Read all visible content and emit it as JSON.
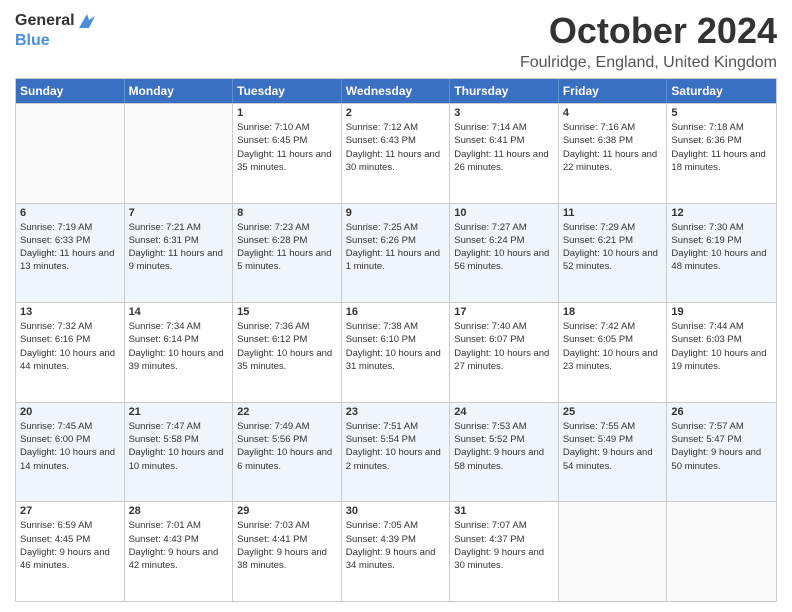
{
  "logo": {
    "general": "General",
    "blue": "Blue"
  },
  "title": {
    "month_year": "October 2024",
    "location": "Foulridge, England, United Kingdom"
  },
  "days_of_week": [
    "Sunday",
    "Monday",
    "Tuesday",
    "Wednesday",
    "Thursday",
    "Friday",
    "Saturday"
  ],
  "weeks": [
    [
      {
        "day": "",
        "sunrise": "",
        "sunset": "",
        "daylight": "",
        "empty": true
      },
      {
        "day": "",
        "sunrise": "",
        "sunset": "",
        "daylight": "",
        "empty": true
      },
      {
        "day": "1",
        "sunrise": "Sunrise: 7:10 AM",
        "sunset": "Sunset: 6:45 PM",
        "daylight": "Daylight: 11 hours and 35 minutes."
      },
      {
        "day": "2",
        "sunrise": "Sunrise: 7:12 AM",
        "sunset": "Sunset: 6:43 PM",
        "daylight": "Daylight: 11 hours and 30 minutes."
      },
      {
        "day": "3",
        "sunrise": "Sunrise: 7:14 AM",
        "sunset": "Sunset: 6:41 PM",
        "daylight": "Daylight: 11 hours and 26 minutes."
      },
      {
        "day": "4",
        "sunrise": "Sunrise: 7:16 AM",
        "sunset": "Sunset: 6:38 PM",
        "daylight": "Daylight: 11 hours and 22 minutes."
      },
      {
        "day": "5",
        "sunrise": "Sunrise: 7:18 AM",
        "sunset": "Sunset: 6:36 PM",
        "daylight": "Daylight: 11 hours and 18 minutes."
      }
    ],
    [
      {
        "day": "6",
        "sunrise": "Sunrise: 7:19 AM",
        "sunset": "Sunset: 6:33 PM",
        "daylight": "Daylight: 11 hours and 13 minutes."
      },
      {
        "day": "7",
        "sunrise": "Sunrise: 7:21 AM",
        "sunset": "Sunset: 6:31 PM",
        "daylight": "Daylight: 11 hours and 9 minutes."
      },
      {
        "day": "8",
        "sunrise": "Sunrise: 7:23 AM",
        "sunset": "Sunset: 6:28 PM",
        "daylight": "Daylight: 11 hours and 5 minutes."
      },
      {
        "day": "9",
        "sunrise": "Sunrise: 7:25 AM",
        "sunset": "Sunset: 6:26 PM",
        "daylight": "Daylight: 11 hours and 1 minute."
      },
      {
        "day": "10",
        "sunrise": "Sunrise: 7:27 AM",
        "sunset": "Sunset: 6:24 PM",
        "daylight": "Daylight: 10 hours and 56 minutes."
      },
      {
        "day": "11",
        "sunrise": "Sunrise: 7:29 AM",
        "sunset": "Sunset: 6:21 PM",
        "daylight": "Daylight: 10 hours and 52 minutes."
      },
      {
        "day": "12",
        "sunrise": "Sunrise: 7:30 AM",
        "sunset": "Sunset: 6:19 PM",
        "daylight": "Daylight: 10 hours and 48 minutes."
      }
    ],
    [
      {
        "day": "13",
        "sunrise": "Sunrise: 7:32 AM",
        "sunset": "Sunset: 6:16 PM",
        "daylight": "Daylight: 10 hours and 44 minutes."
      },
      {
        "day": "14",
        "sunrise": "Sunrise: 7:34 AM",
        "sunset": "Sunset: 6:14 PM",
        "daylight": "Daylight: 10 hours and 39 minutes."
      },
      {
        "day": "15",
        "sunrise": "Sunrise: 7:36 AM",
        "sunset": "Sunset: 6:12 PM",
        "daylight": "Daylight: 10 hours and 35 minutes."
      },
      {
        "day": "16",
        "sunrise": "Sunrise: 7:38 AM",
        "sunset": "Sunset: 6:10 PM",
        "daylight": "Daylight: 10 hours and 31 minutes."
      },
      {
        "day": "17",
        "sunrise": "Sunrise: 7:40 AM",
        "sunset": "Sunset: 6:07 PM",
        "daylight": "Daylight: 10 hours and 27 minutes."
      },
      {
        "day": "18",
        "sunrise": "Sunrise: 7:42 AM",
        "sunset": "Sunset: 6:05 PM",
        "daylight": "Daylight: 10 hours and 23 minutes."
      },
      {
        "day": "19",
        "sunrise": "Sunrise: 7:44 AM",
        "sunset": "Sunset: 6:03 PM",
        "daylight": "Daylight: 10 hours and 19 minutes."
      }
    ],
    [
      {
        "day": "20",
        "sunrise": "Sunrise: 7:45 AM",
        "sunset": "Sunset: 6:00 PM",
        "daylight": "Daylight: 10 hours and 14 minutes."
      },
      {
        "day": "21",
        "sunrise": "Sunrise: 7:47 AM",
        "sunset": "Sunset: 5:58 PM",
        "daylight": "Daylight: 10 hours and 10 minutes."
      },
      {
        "day": "22",
        "sunrise": "Sunrise: 7:49 AM",
        "sunset": "Sunset: 5:56 PM",
        "daylight": "Daylight: 10 hours and 6 minutes."
      },
      {
        "day": "23",
        "sunrise": "Sunrise: 7:51 AM",
        "sunset": "Sunset: 5:54 PM",
        "daylight": "Daylight: 10 hours and 2 minutes."
      },
      {
        "day": "24",
        "sunrise": "Sunrise: 7:53 AM",
        "sunset": "Sunset: 5:52 PM",
        "daylight": "Daylight: 9 hours and 58 minutes."
      },
      {
        "day": "25",
        "sunrise": "Sunrise: 7:55 AM",
        "sunset": "Sunset: 5:49 PM",
        "daylight": "Daylight: 9 hours and 54 minutes."
      },
      {
        "day": "26",
        "sunrise": "Sunrise: 7:57 AM",
        "sunset": "Sunset: 5:47 PM",
        "daylight": "Daylight: 9 hours and 50 minutes."
      }
    ],
    [
      {
        "day": "27",
        "sunrise": "Sunrise: 6:59 AM",
        "sunset": "Sunset: 4:45 PM",
        "daylight": "Daylight: 9 hours and 46 minutes."
      },
      {
        "day": "28",
        "sunrise": "Sunrise: 7:01 AM",
        "sunset": "Sunset: 4:43 PM",
        "daylight": "Daylight: 9 hours and 42 minutes."
      },
      {
        "day": "29",
        "sunrise": "Sunrise: 7:03 AM",
        "sunset": "Sunset: 4:41 PM",
        "daylight": "Daylight: 9 hours and 38 minutes."
      },
      {
        "day": "30",
        "sunrise": "Sunrise: 7:05 AM",
        "sunset": "Sunset: 4:39 PM",
        "daylight": "Daylight: 9 hours and 34 minutes."
      },
      {
        "day": "31",
        "sunrise": "Sunrise: 7:07 AM",
        "sunset": "Sunset: 4:37 PM",
        "daylight": "Daylight: 9 hours and 30 minutes."
      },
      {
        "day": "",
        "sunrise": "",
        "sunset": "",
        "daylight": "",
        "empty": true
      },
      {
        "day": "",
        "sunrise": "",
        "sunset": "",
        "daylight": "",
        "empty": true
      }
    ]
  ]
}
